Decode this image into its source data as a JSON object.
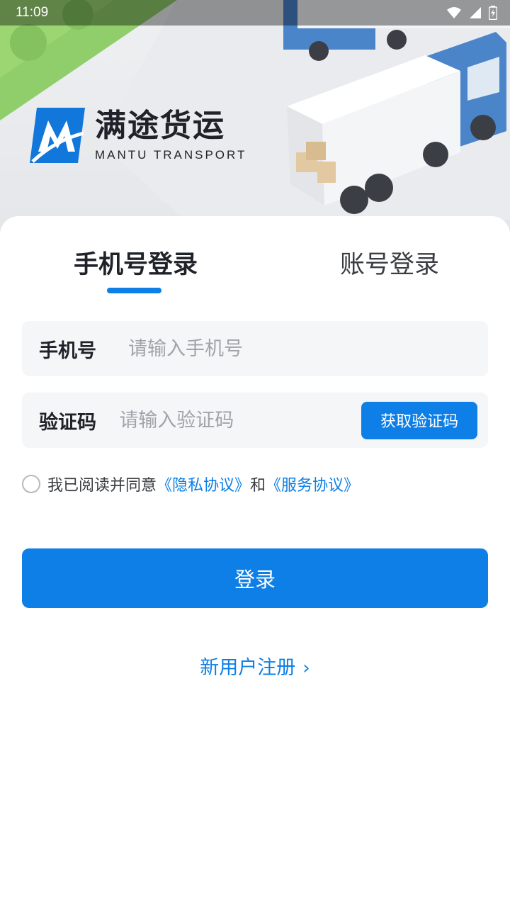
{
  "status_bar": {
    "time": "11:09",
    "icons": [
      "wifi-icon",
      "signal-icon",
      "battery-charging-icon"
    ]
  },
  "brand": {
    "name_cn": "满途货运",
    "name_en": "MANTU TRANSPORT",
    "accent_color": "#0d7fe6"
  },
  "tabs": [
    {
      "label": "手机号登录",
      "active": true
    },
    {
      "label": "账号登录",
      "active": false
    }
  ],
  "form": {
    "phone": {
      "label": "手机号",
      "placeholder": "请输入手机号",
      "value": ""
    },
    "code": {
      "label": "验证码",
      "placeholder": "请输入验证码",
      "value": "",
      "button_label": "获取验证码"
    }
  },
  "agreement": {
    "checked": false,
    "prefix": "我已阅读并同意",
    "privacy_link": "《隐私协议》",
    "and": "和",
    "service_link": "《服务协议》"
  },
  "login_button": "登录",
  "register_link": "新用户注册"
}
